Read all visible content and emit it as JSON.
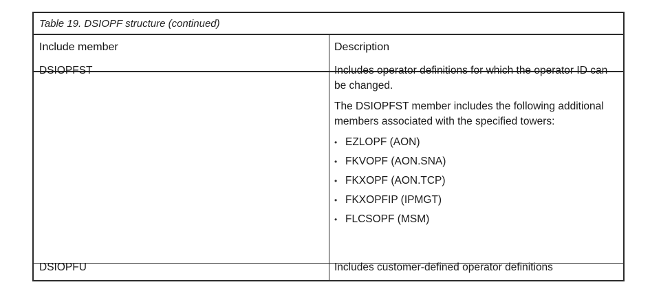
{
  "table": {
    "caption": "Table 19. DSIOPF structure (continued)",
    "headers": {
      "col1": "Include member",
      "col2": "Description"
    },
    "rows": [
      {
        "member": "DSIOPFST",
        "paragraphs": [
          "Includes operator definitions for which the operator ID can be changed.",
          "The DSIOPFST member includes the following additional members associated with the specified towers:"
        ],
        "bullets": [
          "EZLOPF (AON)",
          "FKVOPF (AON.SNA)",
          "FKXOPF (AON.TCP)",
          "FKXOPFIP (IPMGT)",
          "FLCSOPF (MSM)"
        ]
      },
      {
        "member": "DSIOPFU",
        "description": "Includes customer-defined operator definitions"
      }
    ]
  }
}
